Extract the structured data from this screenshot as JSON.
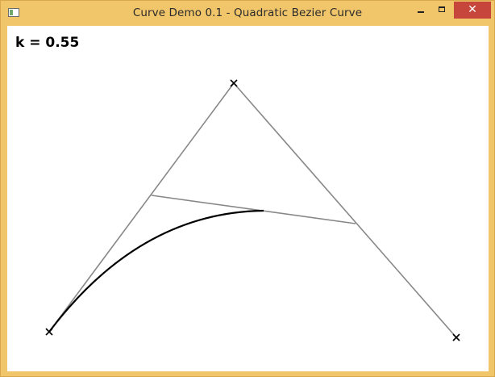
{
  "window": {
    "title": "Curve Demo 0.1 - Quadratic Bezier Curve",
    "controls": {
      "minimize_icon": "minimize-icon",
      "maximize_icon": "maximize-icon",
      "close_icon": "close-icon"
    }
  },
  "canvas": {
    "k_label": "k = 0.55",
    "k": 0.55,
    "colors": {
      "hull": "#888888",
      "curve": "#000000",
      "markers": "#000000"
    }
  }
}
